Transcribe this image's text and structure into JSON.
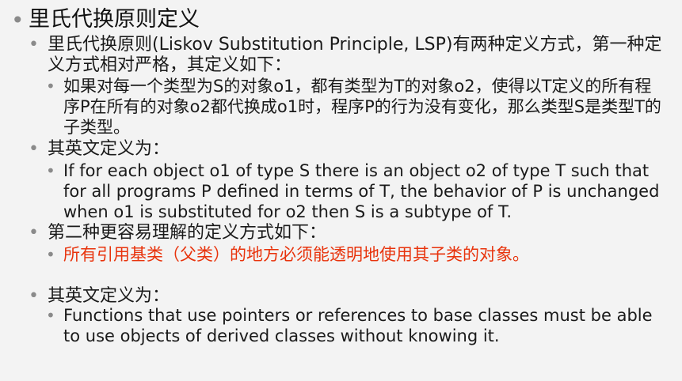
{
  "slide": {
    "title": "里氏代换原则定义",
    "items": [
      {
        "level": 2,
        "text": "里氏代换原则(Liskov Substitution Principle, LSP)有两种定义方式，第一种定义方式相对严格，其定义如下："
      },
      {
        "level": 3,
        "text": "如果对每一个类型为S的对象o1，都有类型为T的对象o2，使得以T定义的所有程序P在所有的对象o2都代换成o1时，程序P的行为没有变化，那么类型S是类型T的子类型。"
      },
      {
        "level": 2,
        "text": "其英文定义为："
      },
      {
        "level": 3,
        "text": "If for each object o1 of type S there is an object o2 of type T such that for all programs P defined in terms of T, the behavior of P is unchanged when o1 is substituted for o2 then S is a subtype of T."
      },
      {
        "level": 2,
        "text": "第二种更容易理解的定义方式如下："
      },
      {
        "level": 3,
        "text": "所有引用基类（父类）的地方必须能透明地使用其子类的对象。",
        "highlight": true
      },
      {
        "level": 2,
        "text": "其英文定义为："
      },
      {
        "level": 3,
        "text": "Functions that use pointers or references to base classes must be able to use objects of derived classes without knowing it."
      }
    ]
  },
  "colors": {
    "background": "#f3f3f3",
    "text": "#1a1a1a",
    "bullet": "#8a8a8a",
    "highlight": "#e8330c"
  }
}
